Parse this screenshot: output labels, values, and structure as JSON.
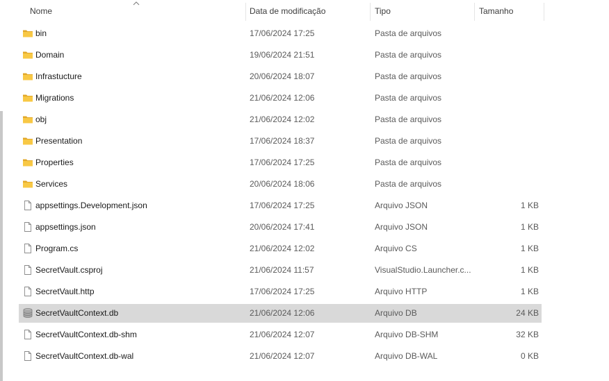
{
  "columns": {
    "name": "Nome",
    "date": "Data de modificação",
    "type": "Tipo",
    "size": "Tamanho"
  },
  "sort": {
    "column": "name",
    "icon": "sort-up-icon"
  },
  "colors": {
    "folder": "#f8c845",
    "folder_dark": "#e2a82a",
    "selection": "#d9d9d9"
  },
  "files": [
    {
      "name": "bin",
      "date": "17/06/2024 17:25",
      "type": "Pasta de arquivos",
      "size": "",
      "icon": "folder-icon"
    },
    {
      "name": "Domain",
      "date": "19/06/2024 21:51",
      "type": "Pasta de arquivos",
      "size": "",
      "icon": "folder-icon"
    },
    {
      "name": "Infrastucture",
      "date": "20/06/2024 18:07",
      "type": "Pasta de arquivos",
      "size": "",
      "icon": "folder-icon"
    },
    {
      "name": "Migrations",
      "date": "21/06/2024 12:06",
      "type": "Pasta de arquivos",
      "size": "",
      "icon": "folder-icon"
    },
    {
      "name": "obj",
      "date": "21/06/2024 12:02",
      "type": "Pasta de arquivos",
      "size": "",
      "icon": "folder-icon"
    },
    {
      "name": "Presentation",
      "date": "17/06/2024 18:37",
      "type": "Pasta de arquivos",
      "size": "",
      "icon": "folder-icon"
    },
    {
      "name": "Properties",
      "date": "17/06/2024 17:25",
      "type": "Pasta de arquivos",
      "size": "",
      "icon": "folder-icon"
    },
    {
      "name": "Services",
      "date": "20/06/2024 18:06",
      "type": "Pasta de arquivos",
      "size": "",
      "icon": "folder-icon"
    },
    {
      "name": "appsettings.Development.json",
      "date": "17/06/2024 17:25",
      "type": "Arquivo JSON",
      "size": "1 KB",
      "icon": "file-icon"
    },
    {
      "name": "appsettings.json",
      "date": "20/06/2024 17:41",
      "type": "Arquivo JSON",
      "size": "1 KB",
      "icon": "file-icon"
    },
    {
      "name": "Program.cs",
      "date": "21/06/2024 12:02",
      "type": "Arquivo CS",
      "size": "1 KB",
      "icon": "file-icon"
    },
    {
      "name": "SecretVault.csproj",
      "date": "21/06/2024 11:57",
      "type": "VisualStudio.Launcher.c...",
      "size": "1 KB",
      "icon": "file-icon"
    },
    {
      "name": "SecretVault.http",
      "date": "17/06/2024 17:25",
      "type": "Arquivo HTTP",
      "size": "1 KB",
      "icon": "file-icon"
    },
    {
      "name": "SecretVaultContext.db",
      "date": "21/06/2024 12:06",
      "type": "Arquivo DB",
      "size": "24 KB",
      "icon": "database-icon",
      "selected": true
    },
    {
      "name": "SecretVaultContext.db-shm",
      "date": "21/06/2024 12:07",
      "type": "Arquivo DB-SHM",
      "size": "32 KB",
      "icon": "file-icon"
    },
    {
      "name": "SecretVaultContext.db-wal",
      "date": "21/06/2024 12:07",
      "type": "Arquivo DB-WAL",
      "size": "0 KB",
      "icon": "file-icon"
    }
  ]
}
